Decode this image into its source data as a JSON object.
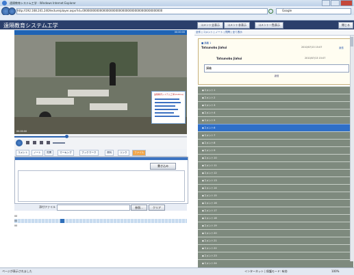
{
  "window": {
    "title": "遠隔教育システム工学 - Windows Internet Explorer",
    "url": "http://192.168.241.240/lecture/player.aspx?id=0000000000000000000000000000000000000000000000",
    "search_engine": "Google"
  },
  "header": {
    "title": "遠隔教育システム工学",
    "buttons": [
      "コメント全表示",
      "コメント非表示",
      "コメント一覧表示",
      "閉じる"
    ]
  },
  "player": {
    "top_right": "00:00:00",
    "slide_title": "遠隔教育システム工学(Outline)",
    "time": "00:00:00"
  },
  "toolbar": {
    "items": [
      "コメント",
      "ノート",
      "質問",
      "マーキング",
      "ブックマーク",
      "資料",
      "リンク",
      "ファイル"
    ]
  },
  "comment": {
    "post_label": "書き込み",
    "file_label": "添付ファイル",
    "browse_label": "参照...",
    "clear_label": "クリア"
  },
  "timeline": {
    "rows": [
      "00",
      "00",
      "00"
    ]
  },
  "right": {
    "header_link": "全件 | コメント | ノート | 質問 | 全て表示",
    "thread": {
      "title": "■ 講義 1",
      "user": "Tatsunobu Jiahui",
      "date": "2010/07/13 15:07",
      "link": "返信",
      "reply_user": "Tatsunobu Jiahui",
      "reply_date": "2010/07/13 15:07",
      "reply_text": "講義",
      "reply_button": "返信"
    },
    "items": [
      "◆コメント1",
      "◆コメント2",
      "◆コメント3",
      "◆コメント4",
      "◆コメント5",
      "◆コメント6",
      "◆コメント7",
      "◆コメント8",
      "◆コメント9",
      "◆コメント10",
      "◆コメント11",
      "◆コメント12",
      "◆コメント13",
      "◆コメント14",
      "◆コメント15",
      "◆コメント16",
      "◆コメント17",
      "◆コメント18",
      "◆コメント19",
      "◆コメント20",
      "◆コメント21",
      "◆コメント22",
      "◆コメント23",
      "◆コメント24"
    ],
    "selected_index": 5
  },
  "status": {
    "left": "ページが表示されました",
    "zone": "インターネット | 保護モード: 有効",
    "zoom": "100%"
  }
}
